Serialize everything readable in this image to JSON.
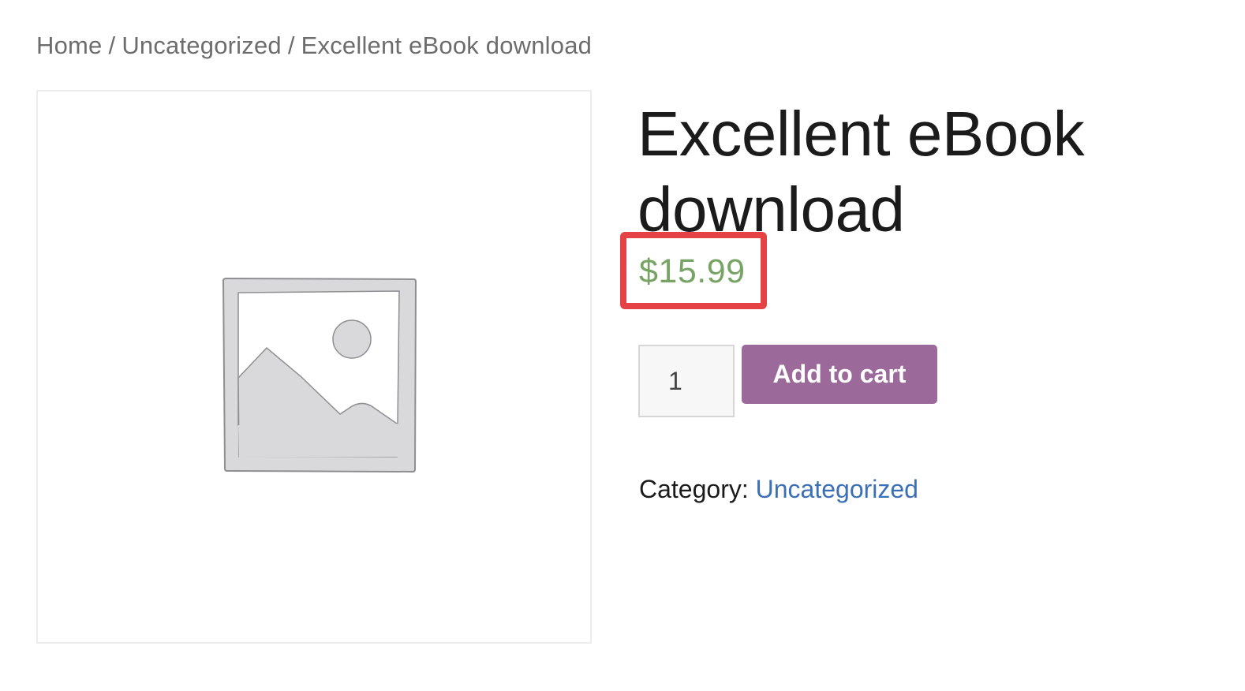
{
  "breadcrumb": {
    "items": [
      "Home",
      "Uncategorized",
      "Excellent eBook download"
    ],
    "separator": "/"
  },
  "product": {
    "title_line1": "Excellent eBook",
    "title_line2": "download",
    "price": "$15.99",
    "quantity": "1",
    "add_to_cart_label": "Add to cart",
    "category_label": "Category:",
    "category_value": "Uncategorized",
    "image_icon": "image-placeholder-icon"
  },
  "colors": {
    "price": "#77a464",
    "button": "#9b6a9b",
    "link": "#3b6fb6",
    "highlight": "#e54245"
  }
}
